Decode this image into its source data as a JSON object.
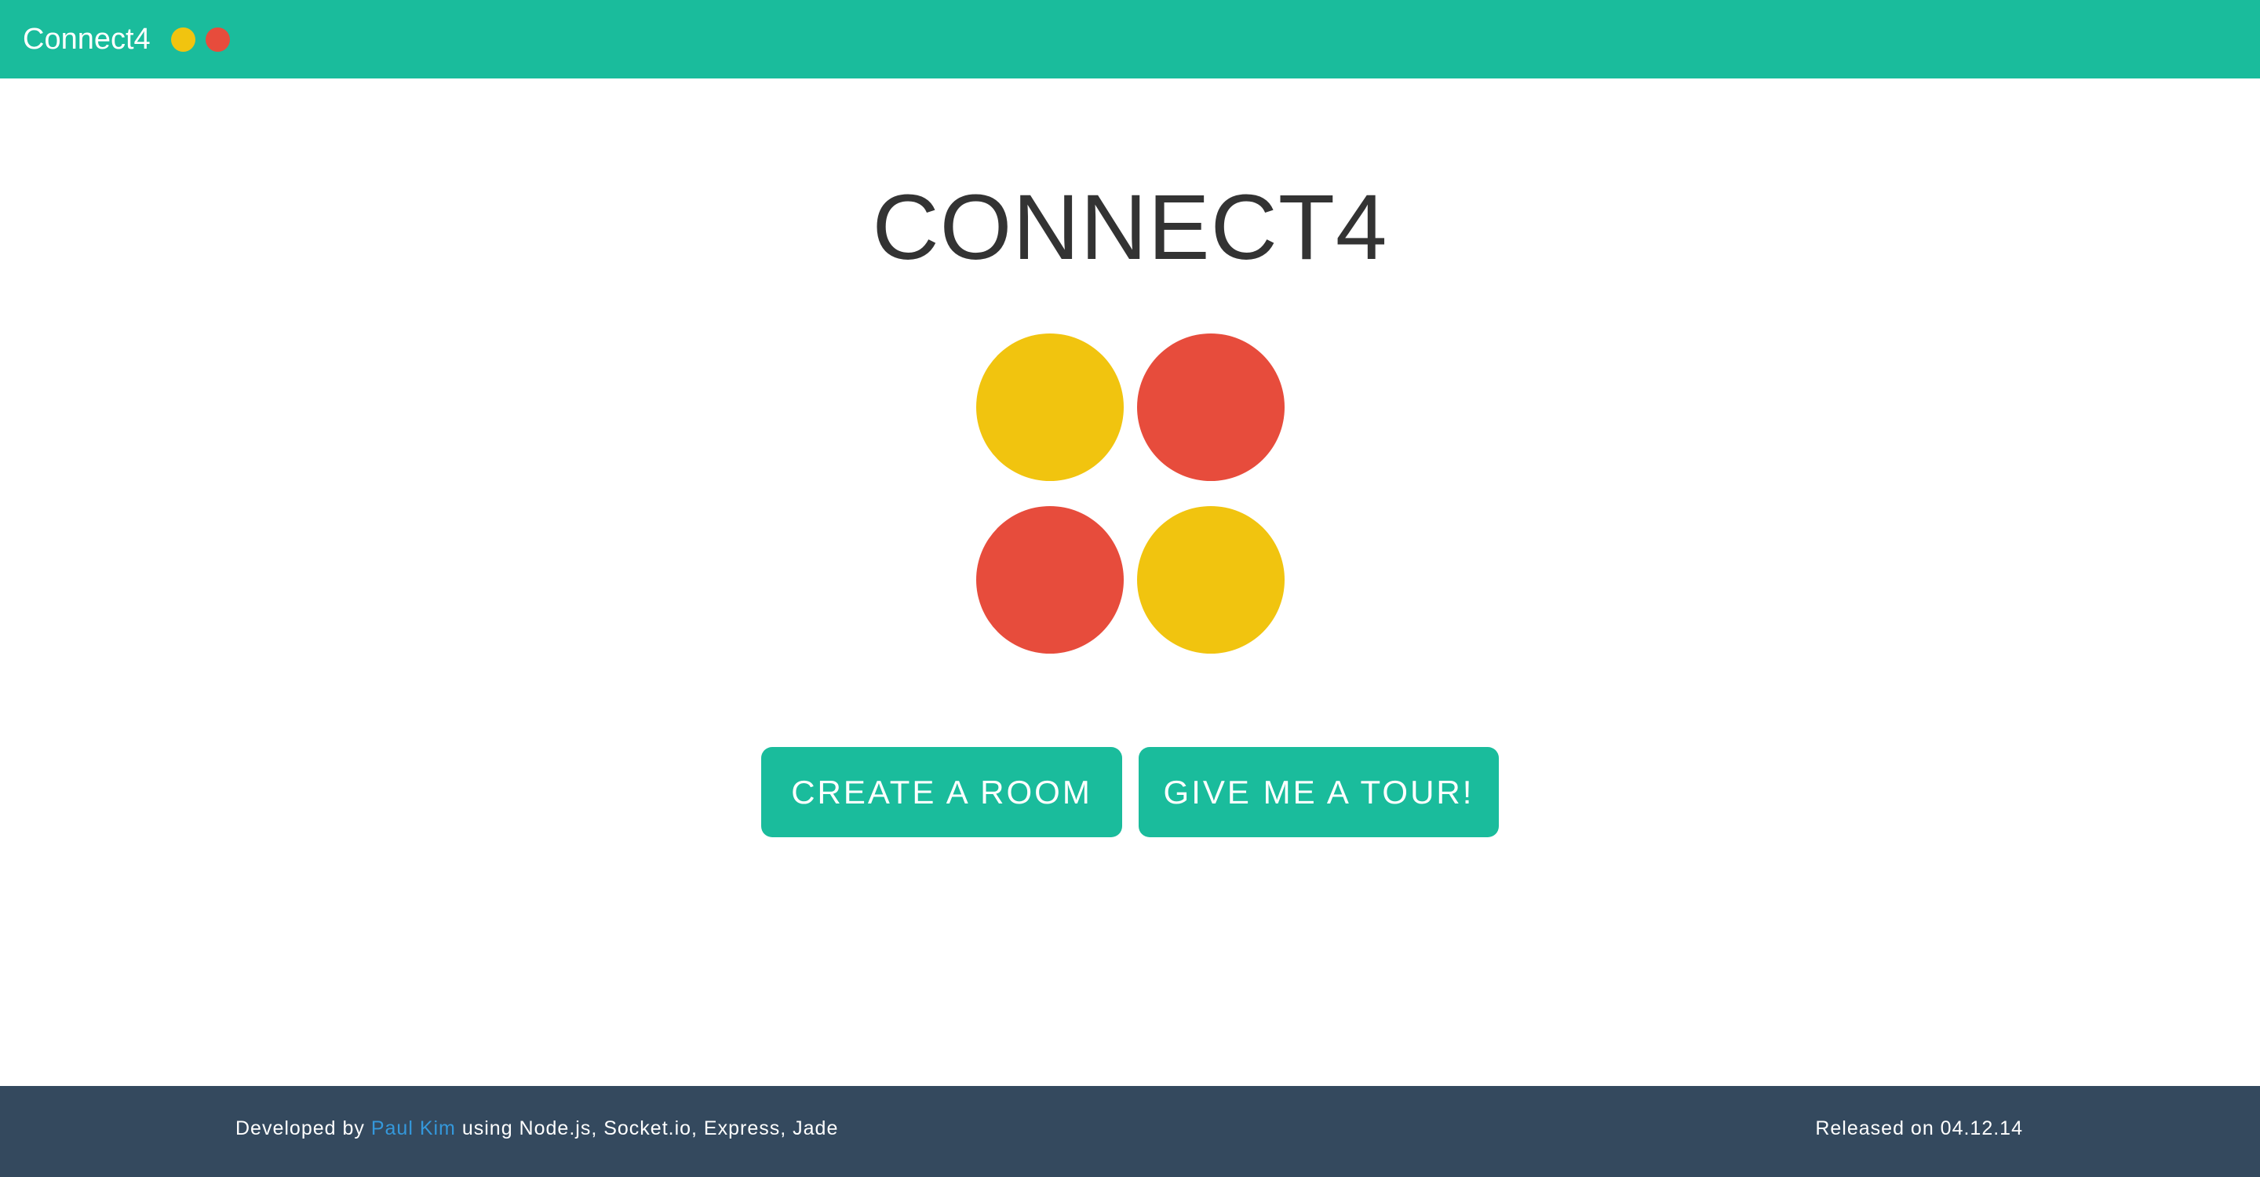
{
  "header": {
    "brand": "Connect4",
    "dot_colors": [
      "#f1c40f",
      "#e74c3c"
    ],
    "background": "#1abc9c"
  },
  "main": {
    "title": "CONNECT4",
    "logo": {
      "discs": [
        {
          "name": "yellow",
          "color": "#f1c40f"
        },
        {
          "name": "red",
          "color": "#e74c3c"
        },
        {
          "name": "red",
          "color": "#e74c3c"
        },
        {
          "name": "yellow",
          "color": "#f1c40f"
        }
      ]
    },
    "buttons": {
      "create_room": "CREATE A ROOM",
      "tour": "GIVE ME A TOUR!"
    }
  },
  "footer": {
    "developed_by_prefix": "Developed by",
    "author": "Paul Kim",
    "tech_suffix": "using Node.js, Socket.io, Express, Jade",
    "released": "Released on 04.12.14",
    "background": "#34495e",
    "link_color": "#3498db"
  }
}
